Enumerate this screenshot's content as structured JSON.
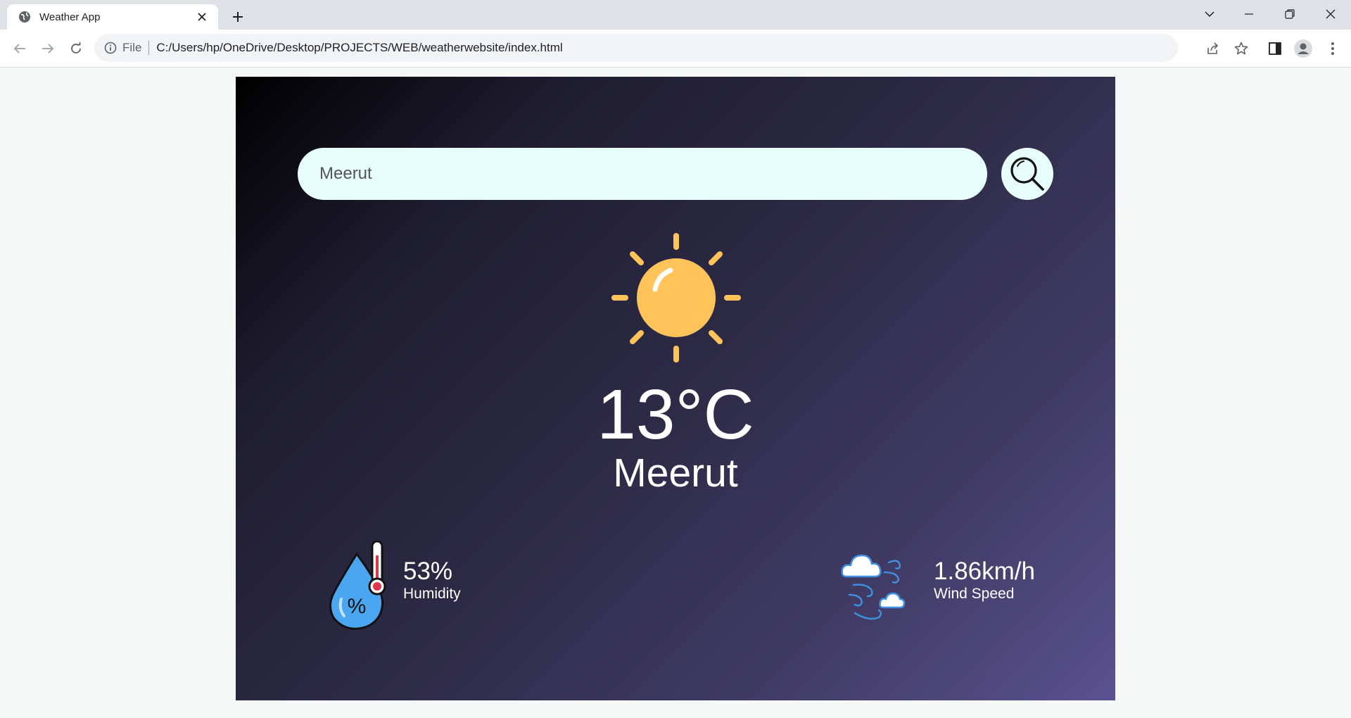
{
  "browser": {
    "tab_title": "Weather App",
    "address_scheme": "File",
    "address_url": "C:/Users/hp/OneDrive/Desktop/PROJECTS/WEB/weatherwebsite/index.html"
  },
  "app": {
    "search_value": "Meerut",
    "weather_icon": "sun-icon",
    "temperature": "13°C",
    "city": "Meerut",
    "humidity": {
      "value": "53%",
      "label": "Humidity",
      "icon": "humidity-icon"
    },
    "wind": {
      "value": "1.86km/h",
      "label": "Wind Speed",
      "icon": "wind-icon"
    }
  },
  "colors": {
    "search_bg": "#e6fdf9",
    "sun": "#ffc35a",
    "card_gradient_start": "#000000",
    "card_gradient_end": "#5a5190"
  }
}
